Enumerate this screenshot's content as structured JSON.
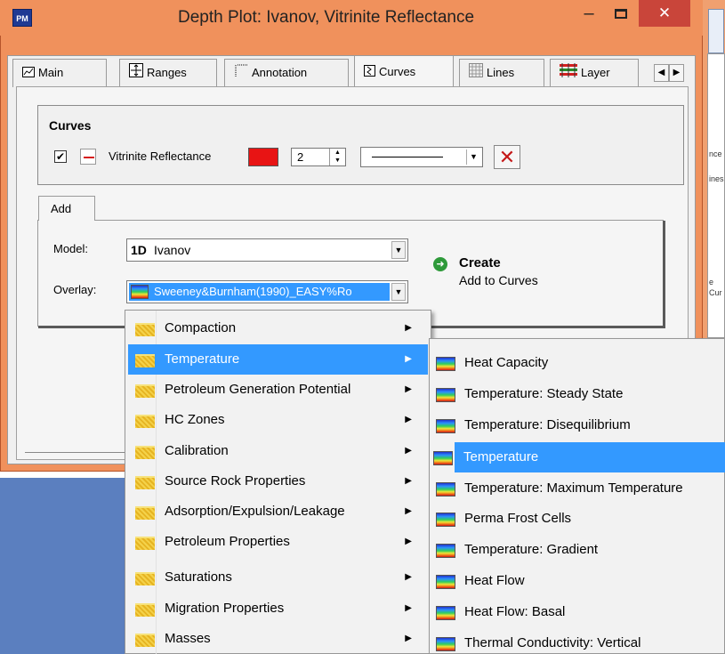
{
  "window": {
    "title": "Depth Plot: Ivanov,  Vitrinite Reflectance",
    "app_icon": "PM",
    "close_glyph": "✕",
    "minimize_glyph": "‒"
  },
  "tabs": [
    {
      "label": "Main",
      "icon": "chart-icon"
    },
    {
      "label": "Ranges",
      "icon": "ranges-icon"
    },
    {
      "label": "Annotation",
      "icon": "annotation-icon"
    },
    {
      "label": "Curves",
      "icon": "curves-icon",
      "active": true
    },
    {
      "label": "Lines",
      "icon": "lines-icon"
    },
    {
      "label": "Layer",
      "icon": "layer-icon"
    }
  ],
  "curves": {
    "group_title": "Curves",
    "checked": true,
    "check_glyph": "✔",
    "curve_name": "Vitrinite Reflectance",
    "color": "#e81414",
    "line_width": "2",
    "delete_glyph": "✕"
  },
  "add": {
    "tab_label": "Add",
    "model_label": "Model:",
    "model_value": "Ivanov",
    "model_icon": "1D",
    "overlay_label": "Overlay:",
    "overlay_value": "Sweeney&Burnham(1990)_EASY%Ro",
    "create_title": "Create",
    "create_subtitle": "Add to Curves"
  },
  "menu_categories": [
    "Compaction",
    "Temperature",
    "Petroleum Generation Potential",
    "HC Zones",
    "Calibration",
    "Source Rock Properties",
    "Adsorption/Expulsion/Leakage",
    "Petroleum Properties",
    "Saturations",
    "Migration Properties",
    "Masses"
  ],
  "menu_categories_highlighted": "Temperature",
  "submenu_items": [
    "Heat Capacity",
    "Temperature: Steady State",
    "Temperature: Disequilibrium",
    "Temperature",
    "Temperature: Maximum Temperature",
    "Perma Frost Cells",
    "Temperature: Gradient",
    "Heat Flow",
    "Heat Flow: Basal",
    "Thermal Conductivity: Vertical"
  ],
  "submenu_highlighted": "Temperature",
  "background_window": {
    "texts": [
      "nce",
      "ines",
      "e",
      "Cur"
    ]
  },
  "colors": {
    "title_bar": "#f0915c",
    "highlight": "#3399ff",
    "close_button": "#c9453a"
  }
}
